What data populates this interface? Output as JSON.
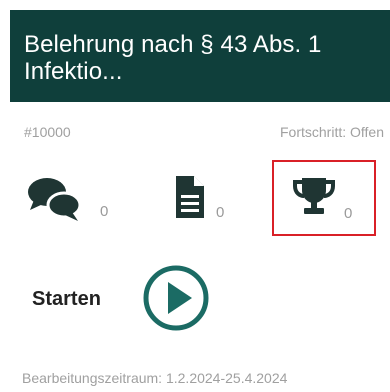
{
  "card": {
    "title": "Belehrung nach § 43 Abs. 1\nInfektio..."
  },
  "meta": {
    "id": "#10000",
    "progress": "Fortschritt: Offen"
  },
  "stats": {
    "comments": {
      "icon": "comments-icon",
      "count": "0"
    },
    "documents": {
      "icon": "document-icon",
      "count": "0"
    },
    "trophies": {
      "icon": "trophy-icon",
      "count": "0",
      "highlight_color": "#d92027"
    }
  },
  "start": {
    "label": "Starten",
    "icon": "play-icon"
  },
  "period": {
    "text": "Bearbeitungszeitraum: 1.2.2024-25.4.2024"
  },
  "colors": {
    "header_bg": "#0f3f3b",
    "accent": "#1b6b64",
    "icon": "#1f3533"
  }
}
